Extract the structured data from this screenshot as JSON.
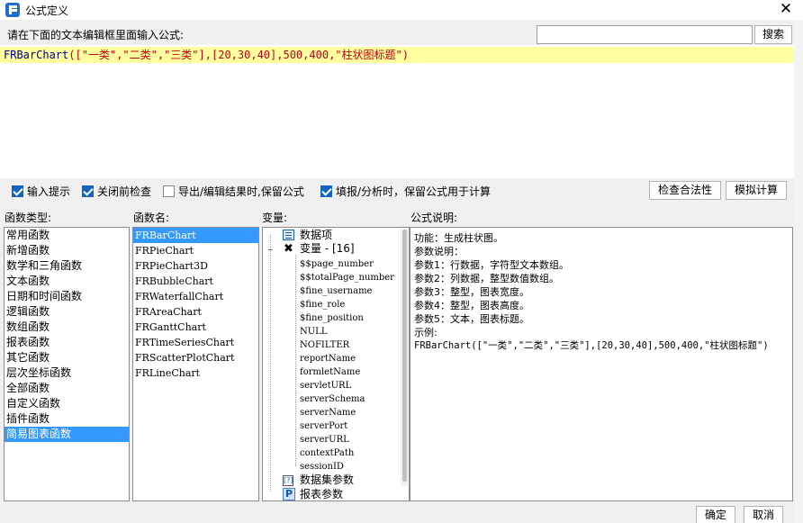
{
  "window": {
    "title": "公式定义",
    "close_symbol": "✕"
  },
  "prompt_label": "请在下面的文本编辑框里面输入公式:",
  "search": {
    "value": "",
    "placeholder": "",
    "button_label": "搜索"
  },
  "editor": {
    "tokens": {
      "fn": "FRBarChart",
      "open": "([",
      "s1": "\"一类\"",
      "c1": ",",
      "s2": "\"二类\"",
      "c2": ",",
      "s3": "\"三类\"",
      "mid": "],[",
      "nums": "20,30,40",
      "close_arr": "],",
      "w": "500",
      "c3": ",",
      "h": "400",
      "c4": ",",
      "title": "\"柱状图标题\"",
      "end": ")"
    }
  },
  "options": [
    {
      "label": "输入提示",
      "checked": true
    },
    {
      "label": "关闭前检查",
      "checked": true
    },
    {
      "label": "导出/编辑结果时,保留公式",
      "checked": false
    },
    {
      "label": "填报/分析时，保留公式用于计算",
      "checked": true
    }
  ],
  "buttons": {
    "check_validity": "检查合法性",
    "simulate": "模拟计算",
    "ok": "确定",
    "cancel": "取消"
  },
  "columns": {
    "func_type": "函数类型:",
    "func_name": "函数名:",
    "variables": "变量:",
    "description": "公式说明:"
  },
  "func_types": [
    "常用函数",
    "新增函数",
    "数学和三角函数",
    "文本函数",
    "日期和时间函数",
    "逻辑函数",
    "数组函数",
    "报表函数",
    "其它函数",
    "层次坐标函数",
    "全部函数",
    "自定义函数",
    "插件函数",
    "简易图表函数"
  ],
  "func_types_selected": 13,
  "func_names": [
    "FRBarChart",
    "FRPieChart",
    "FRPieChart3D",
    "FRBubbleChart",
    "FRWaterfallChart",
    "FRAreaChart",
    "FRGanttChart",
    "FRTimeSeriesChart",
    "FRScatterPlotChart",
    "FRLineChart"
  ],
  "func_names_selected": 0,
  "variables": {
    "data_items": "数据项",
    "variables_label": "变量 - [16]",
    "leaves": [
      "$$page_number",
      "$$totalPage_number",
      "$fine_username",
      "$fine_role",
      "$fine_position",
      "NULL",
      "NOFILTER",
      "reportName",
      "formletName",
      "servletURL",
      "serverSchema",
      "serverName",
      "serverPort",
      "serverURL",
      "contextPath",
      "sessionID"
    ],
    "dataset_params": "数据集参数",
    "report_params": "报表参数",
    "collapse_symbol": "−",
    "expand_symbol": "+"
  },
  "description": [
    "功能：生成柱状图。",
    "参数说明：",
    "参数1：行数据，字符型文本数组。",
    "参数2：列数据，整型数值数组。",
    "参数3：整型，图表宽度。",
    "参数4：整型，图表高度。",
    "参数5：文本，图表标题。",
    "示例:"
  ],
  "description_example": "FRBarChart([\"一类\",\"二类\",\"三类\"],[20,30,40],500,400,\"柱状图标题\")",
  "colors": {
    "selection": "#3399ff",
    "editor_highlight": "#ffffa0",
    "checkbox": "#1565c0"
  }
}
